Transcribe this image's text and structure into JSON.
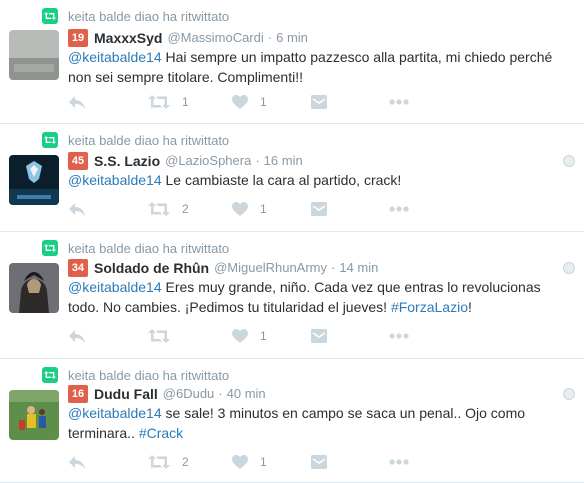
{
  "retweet_text": "keita balde diao ha ritwittato",
  "colors": {
    "retweet_green": "#19cf86",
    "badge_orange": "#e0614b",
    "link_blue": "#2b7bb9",
    "icon_gray": "#ccd6dd"
  },
  "tweets": [
    {
      "badge": "19",
      "name": "MaxxxSyd",
      "handle": "@MassimoCardi",
      "sep": "·",
      "time": "6 min",
      "body": [
        {
          "t": "@keitabalde14",
          "link": true
        },
        {
          "t": " Hai sempre un impatto pazzesco alla partita, mi chiedo perché non sei sempre titolare. Complimenti!!",
          "link": false
        }
      ],
      "retweets": "1",
      "likes": "1",
      "avatar_icon": "grey-photo-avatar"
    },
    {
      "badge": "45",
      "name": "S.S. Lazio",
      "handle": "@LazioSphera",
      "sep": "·",
      "time": "16 min",
      "body": [
        {
          "t": "@keitabalde14",
          "link": true
        },
        {
          "t": " Le cambiaste la cara al partido, crack!",
          "link": false
        }
      ],
      "retweets": "2",
      "likes": "1",
      "avatar_icon": "lazio-crest-avatar"
    },
    {
      "badge": "34",
      "name": "Soldado de Rhûn",
      "handle": "@MiguelRhunArmy",
      "sep": "·",
      "time": "14 min",
      "body": [
        {
          "t": "@keitabalde14",
          "link": true
        },
        {
          "t": " Eres muy grande, niño. Cada vez que entras lo revolucionas todo. No cambies. ¡Pedimos tu titularidad el jueves! ",
          "link": false
        },
        {
          "t": "#ForzaLazio",
          "link": true
        },
        {
          "t": "!",
          "link": false
        }
      ],
      "retweets": "",
      "likes": "1",
      "avatar_icon": "soldier-avatar"
    },
    {
      "badge": "16",
      "name": "Dudu Fall",
      "handle": "@6Dudu",
      "sep": "·",
      "time": "40 min",
      "body": [
        {
          "t": "@keitabalde14",
          "link": true
        },
        {
          "t": " se sale! 3 minutos en campo se saca un penal.. Ojo como terminara.. ",
          "link": false
        },
        {
          "t": "#Crack",
          "link": true
        }
      ],
      "retweets": "2",
      "likes": "1",
      "avatar_icon": "football-match-avatar"
    }
  ]
}
